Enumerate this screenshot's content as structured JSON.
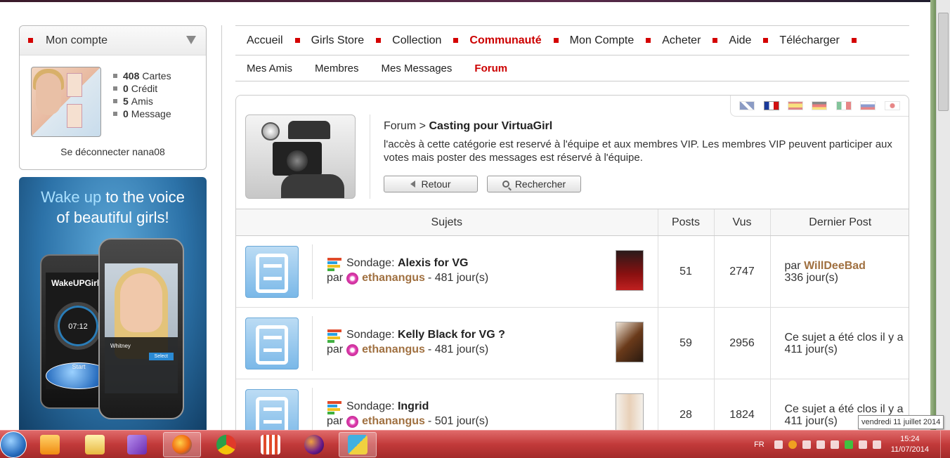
{
  "account": {
    "title": "Mon compte",
    "stats": [
      {
        "value": "408",
        "label": "Cartes"
      },
      {
        "value": "0",
        "label": "Crédit"
      },
      {
        "value": "5",
        "label": "Amis"
      },
      {
        "value": "0",
        "label": "Message"
      }
    ],
    "logout": "Se déconnecter nana08"
  },
  "ad": {
    "title_hl1": "Wake up",
    "title_rest1": " to the voice",
    "title_line2": "of beautiful girls!",
    "app_logo": "WakeUPGirl",
    "time": "07:12",
    "start": "Start",
    "name": "Whitney",
    "select": "Select"
  },
  "nav": {
    "main": [
      "Accueil",
      "Girls Store",
      "Collection",
      "Communauté",
      "Mon Compte",
      "Acheter",
      "Aide",
      "Télécharger"
    ],
    "sub": [
      "Mes Amis",
      "Membres",
      "Mes Messages",
      "Forum"
    ]
  },
  "category": {
    "crumb_root": "Forum",
    "crumb_sep": " > ",
    "crumb_current": "Casting pour VirtuaGirl",
    "description": "l'accès à cette catégorie est reservé à l'équipe et aux membres VIP. Les membres VIP peuvent participer aux votes mais poster des messages est réservé à l'équipe.",
    "back_label": "Retour",
    "search_label": "Rechercher"
  },
  "table": {
    "headers": [
      "Sujets",
      "Posts",
      "Vus",
      "Dernier Post"
    ],
    "rows": [
      {
        "prefix": "Sondage: ",
        "title": "Alexis for VG",
        "by": "par",
        "author": "ethanangus",
        "age": "- 481 jour(s)",
        "posts": "51",
        "views": "2747",
        "last_by": "par",
        "last_user": "WillDeeBad",
        "last_text": "336 jour(s)"
      },
      {
        "prefix": "Sondage: ",
        "title": "Kelly Black for VG ?",
        "by": "par",
        "author": "ethanangus",
        "age": "- 481 jour(s)",
        "posts": "59",
        "views": "2956",
        "last_by": "",
        "last_user": "",
        "last_text": "Ce sujet a été clos il y a 411 jour(s)"
      },
      {
        "prefix": "Sondage: ",
        "title": "Ingrid",
        "by": "par",
        "author": "ethanangus",
        "age": "- 501 jour(s)",
        "posts": "28",
        "views": "1824",
        "last_by": "",
        "last_user": "",
        "last_text": "Ce sujet a été clos il y a 411 jour(s)"
      }
    ]
  },
  "taskbar": {
    "lang": "FR",
    "time": "15:24",
    "date": "11/07/2014",
    "tooltip": "vendredi 11 juillet 2014"
  },
  "colors": {
    "accent": "#cc0000",
    "username": "#a07040",
    "taskbar": "#c23a3a"
  }
}
